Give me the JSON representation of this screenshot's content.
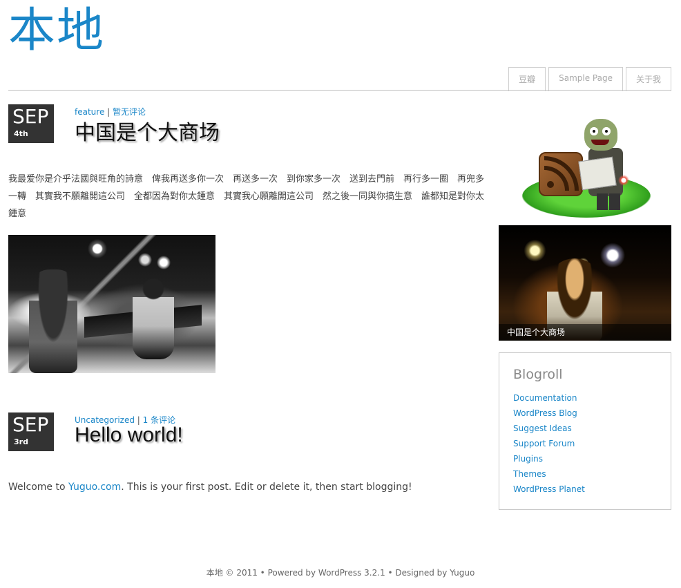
{
  "site": {
    "title": "本地"
  },
  "nav": {
    "items": [
      "豆瓣",
      "Sample Page",
      "关于我"
    ]
  },
  "posts": [
    {
      "month": "SEP",
      "day": "4th",
      "category": "feature",
      "comments": "暂无评论",
      "title": "中国是个大商场",
      "content": "我最爱你是介乎法國與旺角的詩意　俾我再送多你一次　再送多一次　到你家多一次　送到去門前　再行多一圈　再兜多一轉　其實我不願離開這公司　全都因為對你太鍾意　其實我心願離開這公司　然之後一同與你搞生意　誰都知是對你太鍾意"
    },
    {
      "month": "SEP",
      "day": "3rd",
      "category": "Uncategorized",
      "comments": "1 条评论",
      "title": "Hello world!",
      "content_prefix": "Welcome to ",
      "content_link": "Yuguo.com",
      "content_suffix": ". This is your first post. Edit or delete it, then start blogging!"
    }
  ],
  "sidebar": {
    "featured_caption": "中国是个大商场",
    "blogroll": {
      "title": "Blogroll",
      "links": [
        "Documentation",
        "WordPress Blog",
        "Suggest Ideas",
        "Support Forum",
        "Plugins",
        "Themes",
        "WordPress Planet"
      ]
    }
  },
  "footer": {
    "text": "本地 © 2011 • Powered by WordPress 3.2.1 • Designed by Yuguo"
  },
  "colors": {
    "accent": "#1a86c8",
    "date_box": "#333333",
    "border": "#c8c8c8"
  }
}
